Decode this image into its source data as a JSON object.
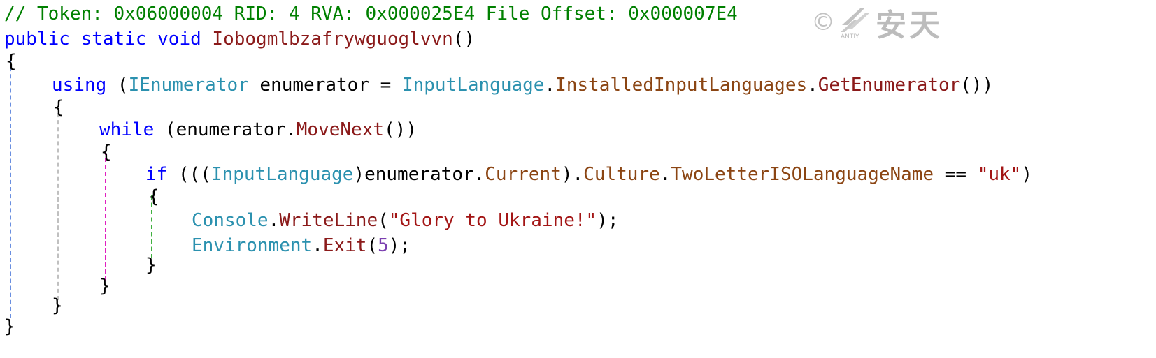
{
  "code": {
    "comment": "// Token: 0x06000004 RID: 4 RVA: 0x000025E4 File Offset: 0x000007E4",
    "signature": {
      "modifiers": "public static void ",
      "method_name": "Iobogmlbzafrywguoglvvn",
      "params": "()"
    },
    "open_brace_1": "{",
    "using_line": {
      "kw_using": "using",
      "space_paren": " (",
      "type_ienumerator": "IEnumerator",
      "var_decl": " enumerator = ",
      "type_inputlanguage": "InputLanguage",
      "dot1": ".",
      "prop_installed": "InstalledInputLanguages",
      "dot2": ".",
      "method_getenum": "GetEnumerator",
      "close": "())"
    },
    "open_brace_2": "{",
    "while_line": {
      "kw_while": "while",
      "mid": " (enumerator.",
      "method_movenext": "MoveNext",
      "close": "())"
    },
    "open_brace_3": "{",
    "if_line": {
      "kw_if": "if",
      "open": " (((",
      "type_inputlanguage": "InputLanguage",
      "cast_close": ")enumerator.",
      "prop_current": "Current",
      "p1": ").",
      "prop_culture": "Culture",
      "dot": ".",
      "prop_twoletter": "TwoLetterISOLanguageName",
      "eq": " == ",
      "str_uk": "\"uk\"",
      "close": ")"
    },
    "open_brace_4": "{",
    "console_line": {
      "type_console": "Console",
      "dot": ".",
      "method_writeline": "WriteLine",
      "open": "(",
      "str_glory": "\"Glory to Ukraine!\"",
      "close": ");"
    },
    "exit_line": {
      "type_environment": "Environment",
      "dot": ".",
      "method_exit": "Exit",
      "open": "(",
      "num_5": "5",
      "close": ");"
    },
    "close_brace_4": "}",
    "close_brace_3": "}",
    "close_brace_2": "}",
    "close_brace_1": "}"
  },
  "watermark": {
    "symbol": "©",
    "logo_text": "ANTIY",
    "chinese": "安天",
    "icon": "antiy-logo-icon"
  },
  "colors": {
    "comment": "#008000",
    "keyword": "#0000ff",
    "type": "#2b91af",
    "method": "#8b1a1a",
    "property": "#8b4513",
    "string": "#a31515",
    "number": "#7b3fb0",
    "guide_blue": "#6a8fe0",
    "guide_gray": "#c0c0c0",
    "guide_magenta": "#e020c0",
    "guide_green": "#40b040"
  }
}
